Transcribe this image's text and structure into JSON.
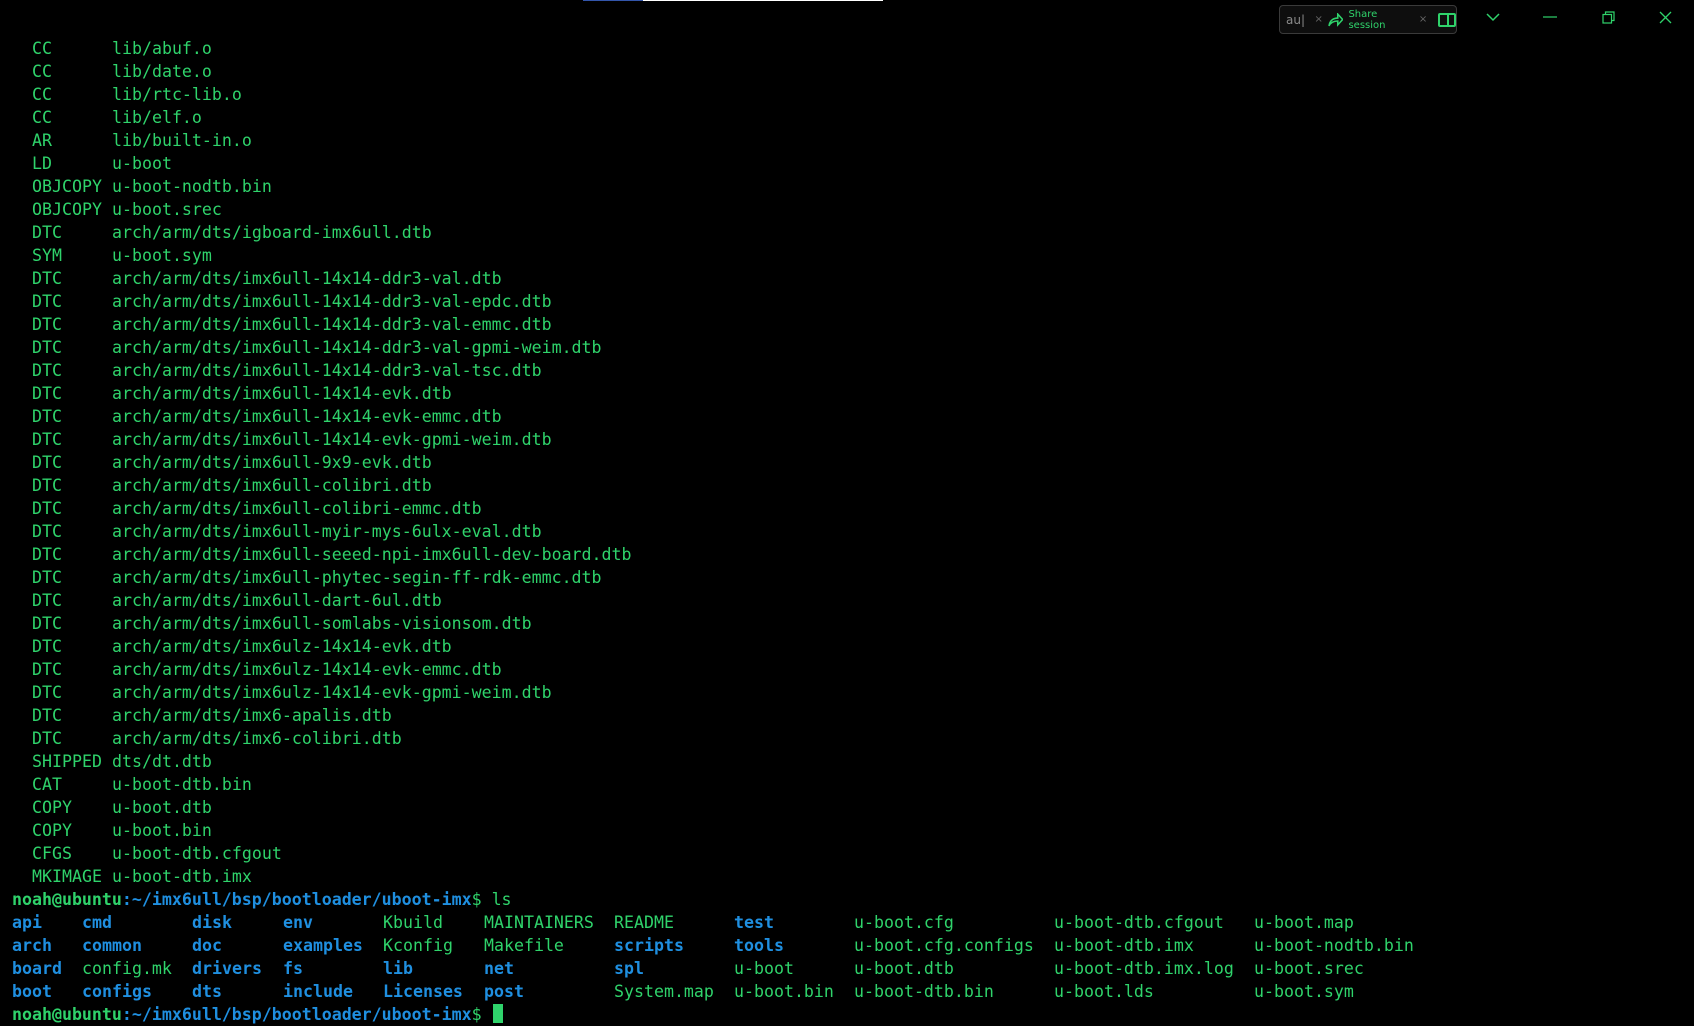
{
  "toolbar": {
    "search_value": "au|",
    "share_label": "Share session"
  },
  "build_log": [
    [
      "CC",
      "lib/abuf.o"
    ],
    [
      "CC",
      "lib/date.o"
    ],
    [
      "CC",
      "lib/rtc-lib.o"
    ],
    [
      "CC",
      "lib/elf.o"
    ],
    [
      "AR",
      "lib/built-in.o"
    ],
    [
      "LD",
      "u-boot"
    ],
    [
      "OBJCOPY",
      "u-boot-nodtb.bin"
    ],
    [
      "OBJCOPY",
      "u-boot.srec"
    ],
    [
      "DTC",
      "arch/arm/dts/igboard-imx6ull.dtb"
    ],
    [
      "SYM",
      "u-boot.sym"
    ],
    [
      "DTC",
      "arch/arm/dts/imx6ull-14x14-ddr3-val.dtb"
    ],
    [
      "DTC",
      "arch/arm/dts/imx6ull-14x14-ddr3-val-epdc.dtb"
    ],
    [
      "DTC",
      "arch/arm/dts/imx6ull-14x14-ddr3-val-emmc.dtb"
    ],
    [
      "DTC",
      "arch/arm/dts/imx6ull-14x14-ddr3-val-gpmi-weim.dtb"
    ],
    [
      "DTC",
      "arch/arm/dts/imx6ull-14x14-ddr3-val-tsc.dtb"
    ],
    [
      "DTC",
      "arch/arm/dts/imx6ull-14x14-evk.dtb"
    ],
    [
      "DTC",
      "arch/arm/dts/imx6ull-14x14-evk-emmc.dtb"
    ],
    [
      "DTC",
      "arch/arm/dts/imx6ull-14x14-evk-gpmi-weim.dtb"
    ],
    [
      "DTC",
      "arch/arm/dts/imx6ull-9x9-evk.dtb"
    ],
    [
      "DTC",
      "arch/arm/dts/imx6ull-colibri.dtb"
    ],
    [
      "DTC",
      "arch/arm/dts/imx6ull-colibri-emmc.dtb"
    ],
    [
      "DTC",
      "arch/arm/dts/imx6ull-myir-mys-6ulx-eval.dtb"
    ],
    [
      "DTC",
      "arch/arm/dts/imx6ull-seeed-npi-imx6ull-dev-board.dtb"
    ],
    [
      "DTC",
      "arch/arm/dts/imx6ull-phytec-segin-ff-rdk-emmc.dtb"
    ],
    [
      "DTC",
      "arch/arm/dts/imx6ull-dart-6ul.dtb"
    ],
    [
      "DTC",
      "arch/arm/dts/imx6ull-somlabs-visionsom.dtb"
    ],
    [
      "DTC",
      "arch/arm/dts/imx6ulz-14x14-evk.dtb"
    ],
    [
      "DTC",
      "arch/arm/dts/imx6ulz-14x14-evk-emmc.dtb"
    ],
    [
      "DTC",
      "arch/arm/dts/imx6ulz-14x14-evk-gpmi-weim.dtb"
    ],
    [
      "DTC",
      "arch/arm/dts/imx6-apalis.dtb"
    ],
    [
      "DTC",
      "arch/arm/dts/imx6-colibri.dtb"
    ],
    [
      "SHIPPED",
      "dts/dt.dtb"
    ],
    [
      "CAT",
      "u-boot-dtb.bin"
    ],
    [
      "COPY",
      "u-boot.dtb"
    ],
    [
      "COPY",
      "u-boot.bin"
    ],
    [
      "CFGS",
      "u-boot-dtb.cfgout"
    ],
    [
      "MKIMAGE",
      "u-boot-dtb.imx"
    ]
  ],
  "prompt": {
    "user": "noah@ubuntu",
    "path": ":~/imx6ull/bsp/bootloader/uboot-imx",
    "symbol": "$ ",
    "command": "ls"
  },
  "ls_rows": [
    [
      [
        "api",
        "dir"
      ],
      [
        "cmd",
        "dir"
      ],
      [
        "disk",
        "dir"
      ],
      [
        "env",
        "dir"
      ],
      [
        "Kbuild",
        "file"
      ],
      [
        "MAINTAINERS",
        "file"
      ],
      [
        "README",
        "file"
      ],
      [
        "test",
        "dir"
      ],
      [
        "u-boot.cfg",
        "file"
      ],
      [
        "u-boot-dtb.cfgout",
        "file"
      ],
      [
        "u-boot.map",
        "file"
      ]
    ],
    [
      [
        "arch",
        "dir"
      ],
      [
        "common",
        "dir"
      ],
      [
        "doc",
        "dir"
      ],
      [
        "examples",
        "dir"
      ],
      [
        "Kconfig",
        "file"
      ],
      [
        "Makefile",
        "file"
      ],
      [
        "scripts",
        "dir"
      ],
      [
        "tools",
        "dir"
      ],
      [
        "u-boot.cfg.configs",
        "file"
      ],
      [
        "u-boot-dtb.imx",
        "file"
      ],
      [
        "u-boot-nodtb.bin",
        "file"
      ]
    ],
    [
      [
        "board",
        "dir"
      ],
      [
        "config.mk",
        "file"
      ],
      [
        "drivers",
        "dir"
      ],
      [
        "fs",
        "dir"
      ],
      [
        "lib",
        "dir"
      ],
      [
        "net",
        "dir"
      ],
      [
        "spl",
        "dir"
      ],
      [
        "u-boot",
        "file"
      ],
      [
        "u-boot.dtb",
        "file"
      ],
      [
        "u-boot-dtb.imx.log",
        "file"
      ],
      [
        "u-boot.srec",
        "file"
      ]
    ],
    [
      [
        "boot",
        "dir"
      ],
      [
        "configs",
        "dir"
      ],
      [
        "dts",
        "dir"
      ],
      [
        "include",
        "dir"
      ],
      [
        "Licenses",
        "dir"
      ],
      [
        "post",
        "dir"
      ],
      [
        "System.map",
        "file"
      ],
      [
        "u-boot.bin",
        "file"
      ],
      [
        "u-boot-dtb.bin",
        "file"
      ],
      [
        "u-boot.lds",
        "file"
      ],
      [
        "u-boot.sym",
        "file"
      ]
    ]
  ]
}
